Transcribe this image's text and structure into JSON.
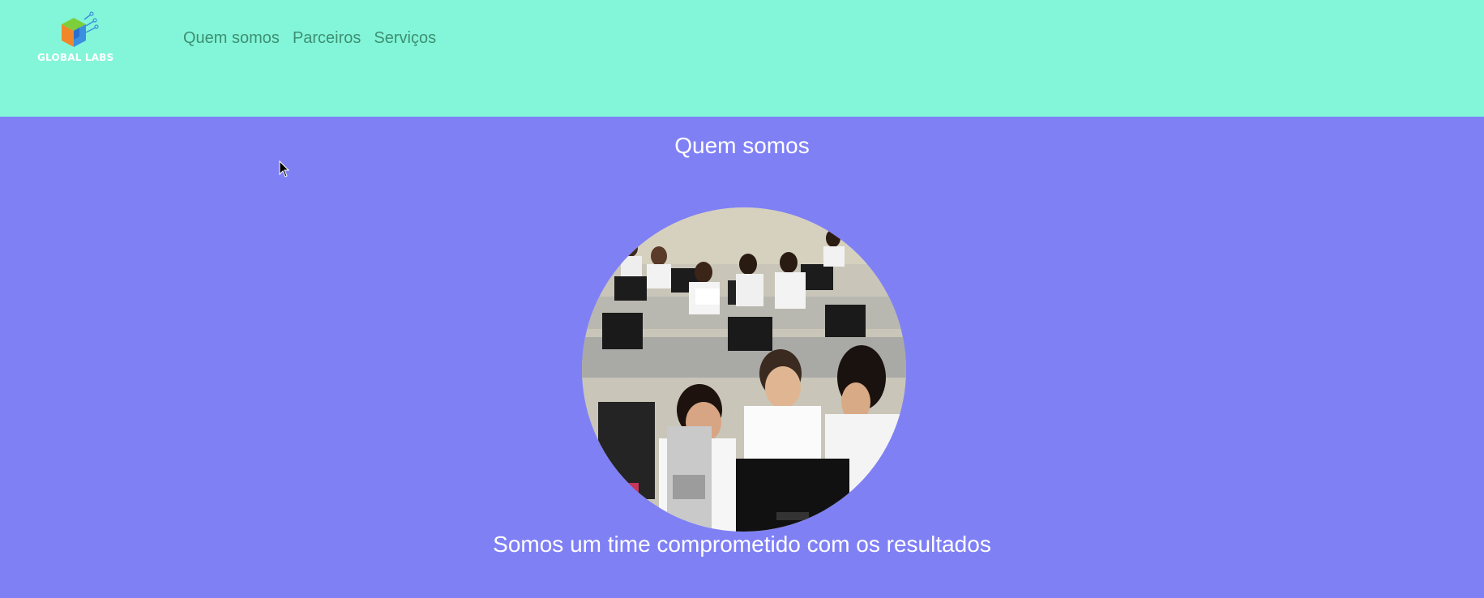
{
  "header": {
    "logo_text": "GLOBAL LABS",
    "nav": [
      {
        "label": "Quem somos"
      },
      {
        "label": "Parceiros"
      },
      {
        "label": "Serviços"
      }
    ]
  },
  "main": {
    "title": "Quem somos",
    "subtitle": "Somos um time comprometido com os resultados"
  },
  "colors": {
    "header_bg": "#83f6d9",
    "main_bg": "#8080f5",
    "nav_text": "#3e8f72",
    "text_light": "#ffffff"
  },
  "icons": {
    "logo": "cube-logo-icon",
    "cursor": "mouse-pointer-icon"
  }
}
